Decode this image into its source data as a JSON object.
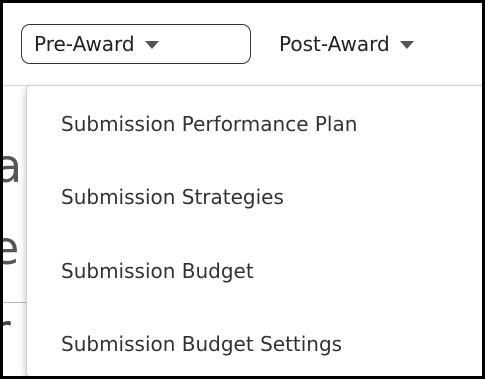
{
  "nav": {
    "pre_award_label": "Pre-Award",
    "post_award_label": "Post-Award"
  },
  "dropdown": {
    "items": [
      {
        "label": "Submission Performance Plan"
      },
      {
        "label": "Submission Strategies"
      },
      {
        "label": "Submission Budget"
      },
      {
        "label": "Submission Budget Settings"
      }
    ]
  },
  "background": {
    "fragment_1": "a",
    "fragment_2": "e",
    "fragment_3": "r"
  },
  "colors": {
    "border": "#000000",
    "text": "#333333",
    "caret": "#555555"
  }
}
